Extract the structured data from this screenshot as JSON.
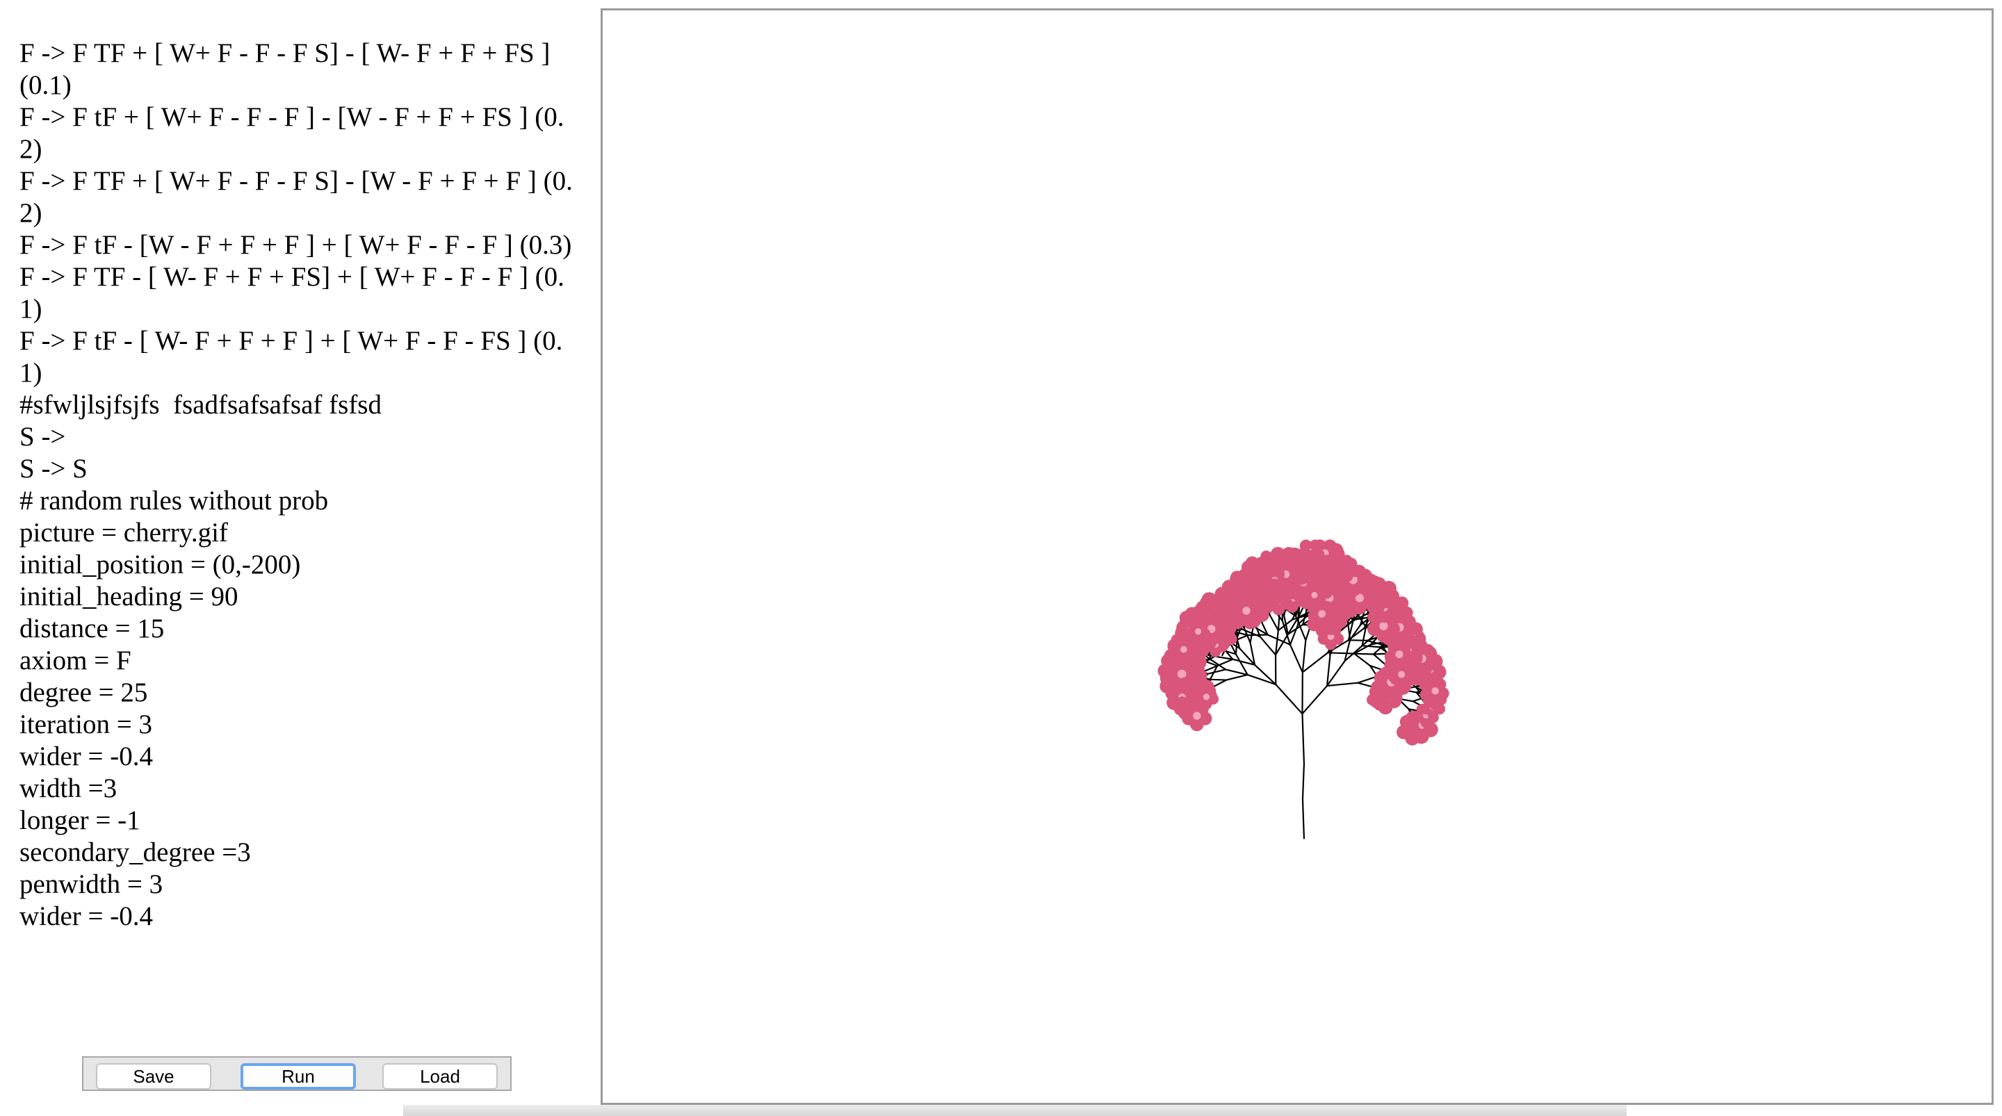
{
  "editor": {
    "lines": [
      "F -> F TF + [ W+ F - F - F S] - [ W- F + F + FS ] (0.1)",
      "F -> F tF + [ W+ F - F - F ] - [W - F + F + FS ] (0.2)",
      "F -> F TF + [ W+ F - F - F S] - [W - F + F + F ] (0.2)",
      "F -> F tF - [W - F + F + F ] + [ W+ F - F - F ] (0.3)",
      "F -> F TF - [ W- F + F + FS] + [ W+ F - F - F ] (0.1)",
      "F -> F tF - [ W- F + F + F ] + [ W+ F - F - FS ] (0.1)",
      "#sfwljlsjfsjfs  fsadfsafsafsaf fsfsd",
      "S ->",
      "S -> S",
      "# random rules without prob",
      "picture = cherry.gif",
      "initial_position = (0,-200)",
      "initial_heading = 90",
      "distance = 15",
      "axiom = F",
      "degree = 25",
      "iteration = 3",
      "wider = -0.4",
      "width =3",
      "longer = -1",
      "secondary_degree =3",
      "penwidth = 3",
      "wider = -0.4"
    ]
  },
  "buttons": {
    "save": "Save",
    "run": "Run",
    "load": "Load"
  },
  "canvas": {
    "branch_color": "#000000",
    "blossom_color": "#d9557a",
    "blossom_center_color": "#f3a6bd"
  }
}
